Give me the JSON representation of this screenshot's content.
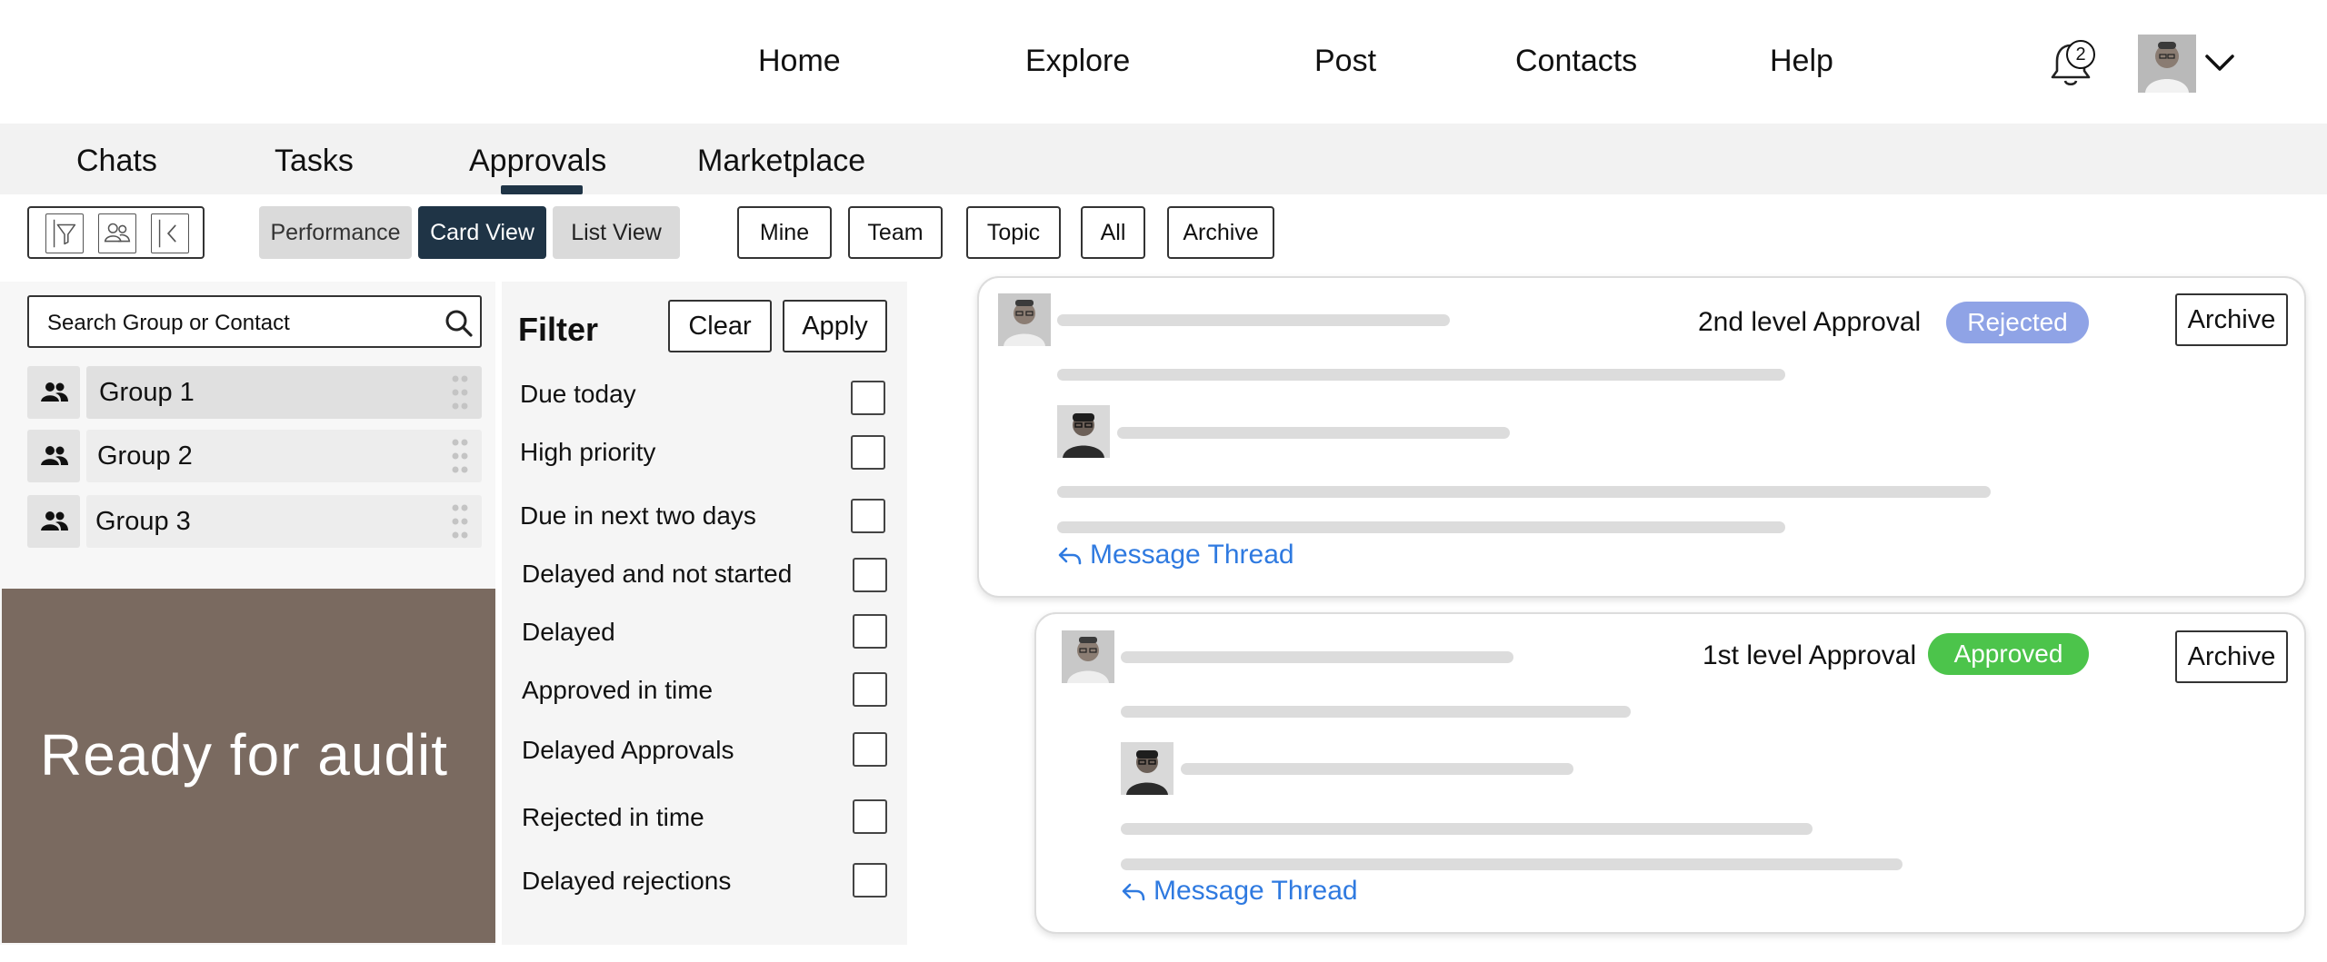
{
  "nav": {
    "links": [
      "Home",
      "Explore",
      "Post",
      "Contacts",
      "Help"
    ],
    "notifications": {
      "count": "2",
      "icon": "bell-icon"
    },
    "user_menu_icon": "chevron-down-icon"
  },
  "tabs": {
    "items": [
      "Chats",
      "Tasks",
      "Approvals",
      "Marketplace"
    ],
    "active": "Approvals"
  },
  "toolbar": {
    "icons": [
      "filter-icon",
      "people-icon",
      "collapse-left-icon"
    ],
    "views": [
      "Performance",
      "Card View",
      "List View"
    ],
    "active_view": "Card View",
    "scopes": [
      "Mine",
      "Team",
      "Topic",
      "All",
      "Archive"
    ]
  },
  "sidebar": {
    "search_placeholder": "Search Group or Contact",
    "groups": [
      "Group 1",
      "Group 2",
      "Group 3"
    ],
    "audit_banner": "Ready for audit"
  },
  "filter": {
    "title": "Filter",
    "clear_label": "Clear",
    "apply_label": "Apply",
    "options": [
      "Due today",
      "High priority",
      "Due in next two days",
      "Delayed and not started",
      "Delayed",
      "Approved in time",
      "Delayed Approvals",
      "Rejected in time",
      "Delayed rejections"
    ]
  },
  "cards": [
    {
      "approval_level": "2nd level Approval",
      "status": "Rejected",
      "status_color": "#8fa3e6",
      "archive_label": "Archive",
      "thread_label": "Message Thread"
    },
    {
      "approval_level": "1st level Approval",
      "status": "Approved",
      "status_color": "#4cc44b",
      "archive_label": "Archive",
      "thread_label": "Message Thread"
    }
  ],
  "colors": {
    "active_tab_underline": "#1f3446",
    "active_view_bg": "#1f3446",
    "link_blue": "#2f7ae0",
    "audit_bg": "#7a6a60"
  }
}
